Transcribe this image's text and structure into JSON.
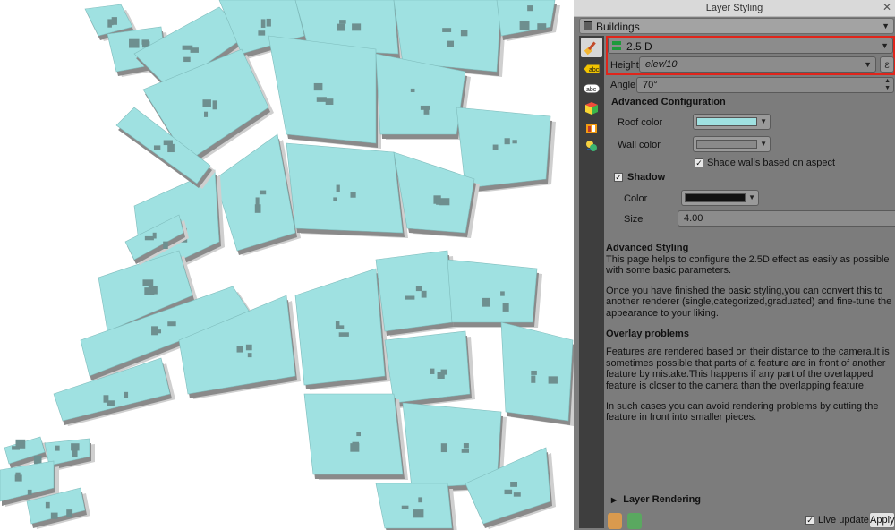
{
  "panel": {
    "title": "Layer Styling",
    "close_glyph": "✕",
    "layer": "Buildings",
    "renderer": "2.5 D",
    "height_label": "Height",
    "height_value": "elev/10",
    "angle_label": "Angle",
    "angle_value": "70°",
    "advanced_title": "Advanced Configuration",
    "roof_label": "Roof color",
    "roof_color": "#9fe1e1",
    "wall_label": "Wall color",
    "wall_color": "#8a8a8a",
    "shade_label": "Shade walls based on aspect",
    "shadow_label": "Shadow",
    "shadow_color_label": "Color",
    "shadow_color": "#111111",
    "size_label": "Size",
    "size_value": "4.00",
    "layer_rendering_label": "Layer Rendering",
    "live_update_label": "Live update",
    "apply_label": "Apply"
  },
  "help": {
    "title": "Advanced Styling",
    "p1": "This page helps to configure the 2.5D effect as easily as possible with some basic parameters.",
    "p2": "Once you have finished the basic styling,you can convert this to another renderer (single,categorized,graduated) and fine-tune the appearance to your liking.",
    "overlay_title": "Overlay problems",
    "p3": "Features are rendered based on their distance to the camera.It is sometimes possible that parts of a feature are in front of another feature by mistake.This happens if any part of the overlapped feature is closer to the camera than the overlapping feature.",
    "p4": "In such cases you can avoid rendering problems by cutting the feature in front into smaller pieces."
  },
  "tabs": [
    "symbology-tab",
    "labels-tab",
    "abc-labels-tab",
    "3d-view-tab",
    "diagrams-tab",
    "history-tab"
  ],
  "colors": {
    "accent_highlight": "#e0251b",
    "building_roof": "#9fe1e1",
    "building_wall": "#8a8a8a"
  }
}
